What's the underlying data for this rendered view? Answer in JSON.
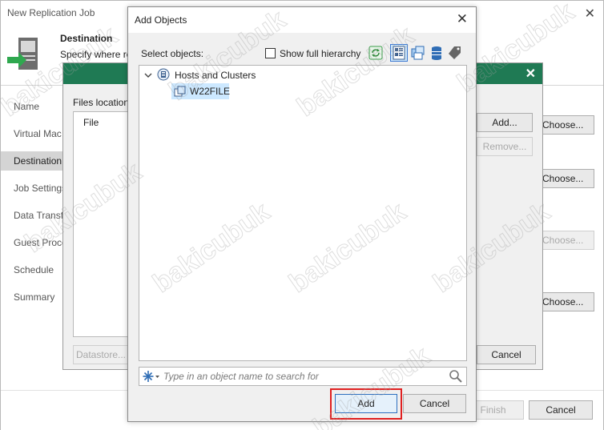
{
  "wizard": {
    "title": "New Replication Job",
    "header_title": "Destination",
    "header_subtitle": "Specify where re",
    "nav": [
      "Name",
      "Virtual Mac",
      "Destination",
      "Job Settings",
      "Data Transfe",
      "Guest Proce",
      "Schedule",
      "Summary"
    ],
    "active_nav": "Destination",
    "right_buttons": {
      "add": "Add...",
      "remove": "Remove...",
      "choose1": "Choose...",
      "choose2": "Choose...",
      "choose3": "Choose...",
      "choose4": "Choose...",
      "cancel_mid": "Cancel"
    },
    "finish": "Finish",
    "cancel": "Cancel"
  },
  "middle_dialog": {
    "files_location_label": "Files location",
    "list_header": "File",
    "datastore_button": "Datastore..."
  },
  "add_objects": {
    "title": "Add Objects",
    "select_label": "Select objects:",
    "show_full_hierarchy": "Show full hierarchy",
    "show_full_hierarchy_checked": false,
    "tree": {
      "root": "Hosts and Clusters",
      "child": "W22FILE"
    },
    "search_placeholder": "Type in an object name to search for",
    "add_button": "Add",
    "cancel_button": "Cancel",
    "toolbar_icons": [
      "refresh-icon",
      "hosts-view-icon",
      "vms-view-icon",
      "datastores-view-icon",
      "tags-view-icon"
    ],
    "active_view": "hosts-view-icon"
  },
  "watermark": "bakicubuk",
  "colors": {
    "accent_green": "#1f7a54",
    "selection_blue": "#cce8ff",
    "highlight_red": "#e02020"
  }
}
